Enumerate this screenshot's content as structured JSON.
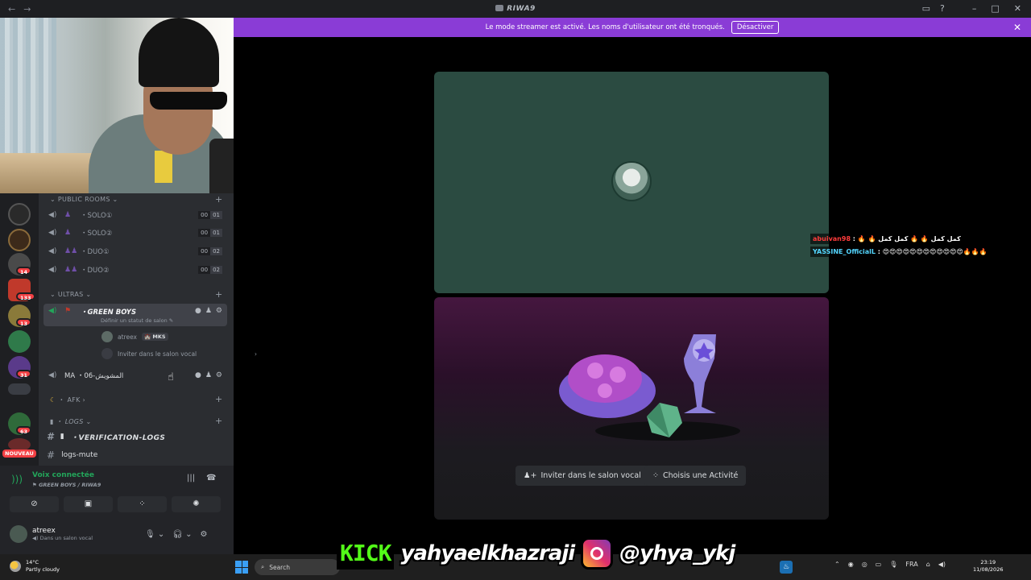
{
  "titlebar": {
    "app_title": "RIWA9",
    "back": "←",
    "forward": "→",
    "inbox": "▭",
    "help": "?",
    "minimize": "–",
    "maximize": "□",
    "close": "✕"
  },
  "banner": {
    "text": "Le mode streamer est activé. Les noms d'utilisateur ont été tronqués.",
    "button": "Désactiver",
    "close": "✕"
  },
  "servers": {
    "badges": [
      "14",
      "133",
      "13",
      "31",
      "63"
    ],
    "nouveau": "NOUVEAU"
  },
  "channels": {
    "public_rooms": {
      "label": "PUBLIC ROOMS",
      "items": [
        {
          "name": "SOLO①",
          "a": "00",
          "b": "01"
        },
        {
          "name": "SOLO②",
          "a": "00",
          "b": "01"
        },
        {
          "name": "DUO①",
          "a": "00",
          "b": "02"
        },
        {
          "name": "DUO②",
          "a": "00",
          "b": "02"
        }
      ]
    },
    "ultras": {
      "label": "ULTRAS",
      "active_channel": "GREEN BOYS",
      "active_status": "Définir un statut de salon",
      "member_name": "atreex",
      "member_tag": "MKS",
      "invite": "Inviter dans le salon vocal",
      "second_channel_prefix": "MA",
      "second_channel": "06-المشويش"
    },
    "afk": {
      "label": "AFK"
    },
    "logs": {
      "label": "LOGS",
      "items": [
        "VERIFICATION-LOGS",
        "logs-mute"
      ]
    }
  },
  "voice_panel": {
    "status": "Voix connectée",
    "location": "GREEN BOYS / RIWA9"
  },
  "user_panel": {
    "name": "atreex",
    "status": "Dans un salon vocal"
  },
  "stage": {
    "invite_button": "Inviter dans le salon vocal",
    "activity_button": "Choisis une Activité"
  },
  "chat_overlay": [
    {
      "user": "abuivan98",
      "message": "🔥 🔥 كمل كمل 🔥 🔥 كمل كمل"
    },
    {
      "user": "YASSINE_OfficialL",
      "message": "😍😍😍😍😍😍😍😍😍😍😍😍🔥🔥🔥"
    }
  ],
  "social": {
    "kick_logo": "KICK",
    "kick_handle": "yahyaelkhazraji",
    "insta_handle": "@yhya_ykj"
  },
  "taskbar": {
    "temperature": "14°C",
    "weather": "Partly cloudy",
    "search_placeholder": "Search",
    "language": "FRA",
    "time": "23:19",
    "date": "11/08/2026"
  },
  "colors": {
    "banner": "#8a3cd6",
    "voice_green": "#23a55a",
    "kick_green": "#53fc18",
    "tile_green": "#2b4b41"
  }
}
